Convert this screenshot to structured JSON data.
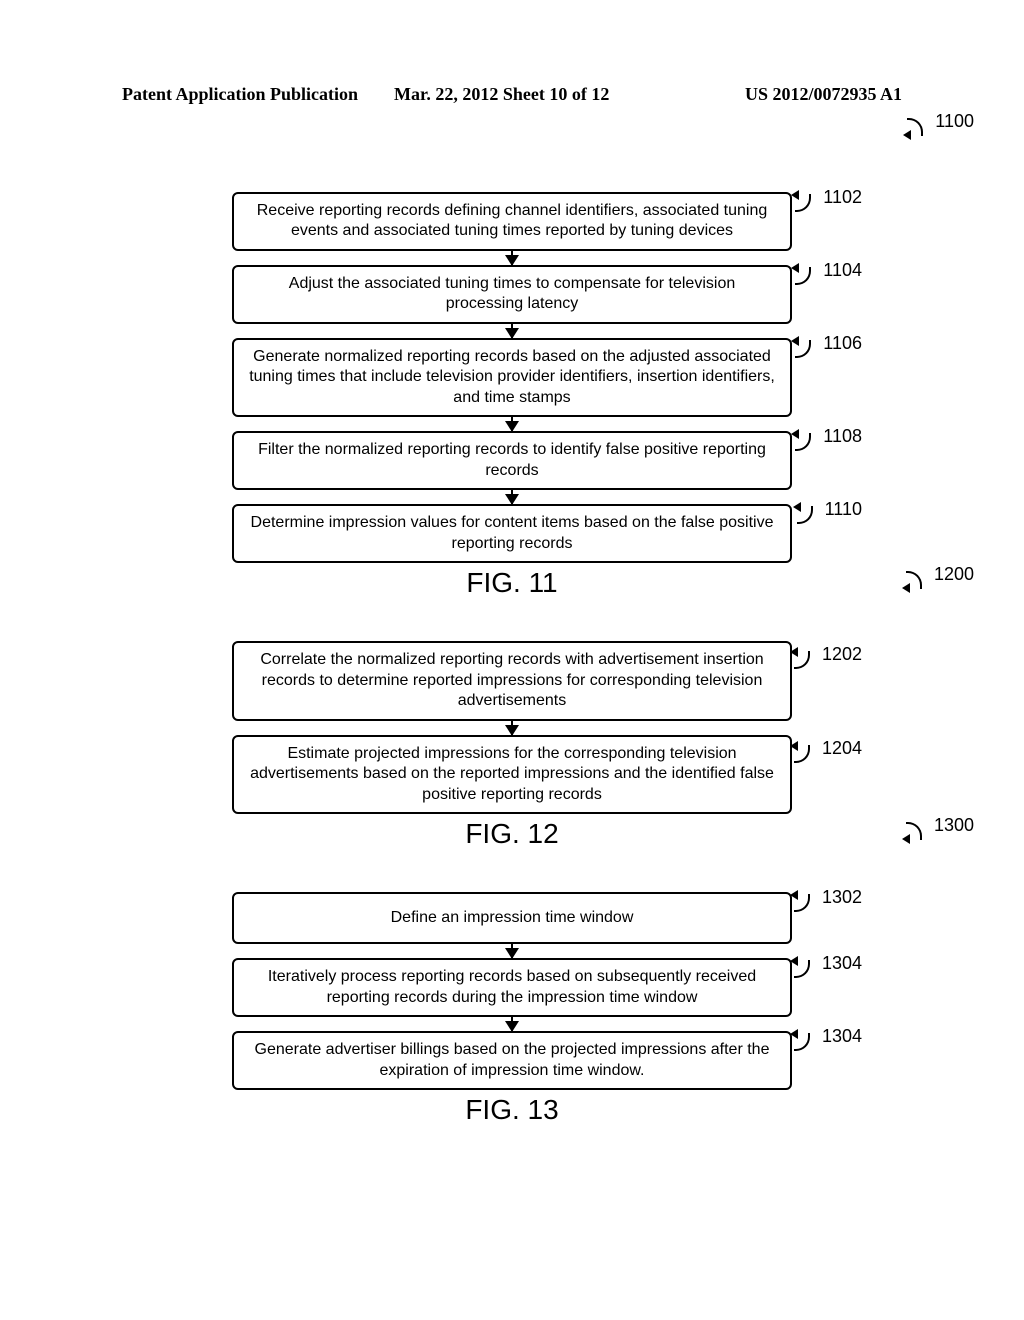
{
  "header": {
    "left": "Patent Application Publication",
    "mid": "Mar. 22, 2012  Sheet 10 of 12",
    "right": "US 2012/0072935 A1"
  },
  "fig11": {
    "ref": "1100",
    "label": "FIG. 11",
    "steps": [
      {
        "ref": "1102",
        "text": "Receive reporting records defining channel identifiers, associated tuning events and associated tuning times reported by tuning devices"
      },
      {
        "ref": "1104",
        "text": "Adjust the associated tuning times to compensate for television processing latency"
      },
      {
        "ref": "1106",
        "text": "Generate normalized reporting records based on the adjusted associated tuning times that include television provider identifiers, insertion identifiers, and time stamps"
      },
      {
        "ref": "1108",
        "text": "Filter the normalized reporting records to identify false positive reporting records"
      },
      {
        "ref": "1110",
        "text": "Determine impression values for content items based on the false positive reporting records"
      }
    ]
  },
  "fig12": {
    "ref": "1200",
    "label": "FIG. 12",
    "steps": [
      {
        "ref": "1202",
        "text": "Correlate the normalized reporting records with advertisement insertion records to determine reported impressions for corresponding television advertisements"
      },
      {
        "ref": "1204",
        "text": "Estimate projected impressions for the corresponding television advertisements based on the reported impressions and the identified false positive reporting records"
      }
    ]
  },
  "fig13": {
    "ref": "1300",
    "label": "FIG. 13",
    "steps": [
      {
        "ref": "1302",
        "text": "Define an impression time window"
      },
      {
        "ref": "1304",
        "text": "Iteratively process reporting records based on subsequently received reporting records during the impression time window"
      },
      {
        "ref": "1304",
        "text": "Generate advertiser billings based on the projected impressions after the expiration of impression time window."
      }
    ]
  }
}
